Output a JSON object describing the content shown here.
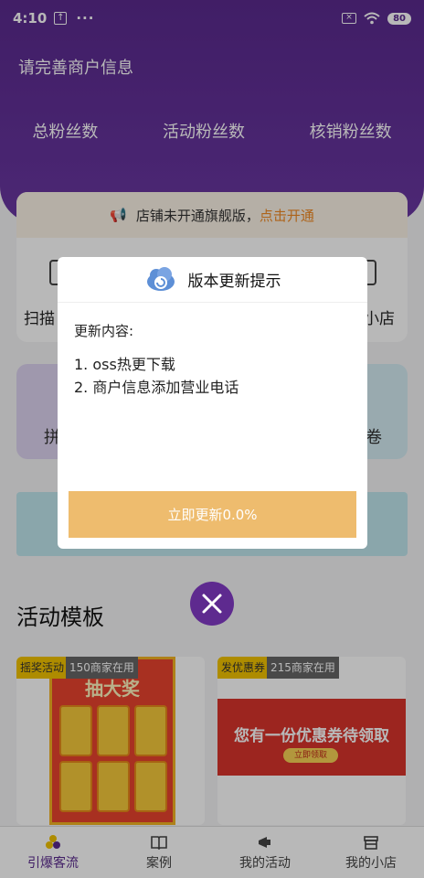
{
  "status_bar": {
    "time": "4:10",
    "battery": "80"
  },
  "header": {
    "title": "请完善商户信息",
    "stats": [
      "总粉丝数",
      "活动粉丝数",
      "核销粉丝数"
    ]
  },
  "notice": {
    "text": "店铺未开通旗舰版，",
    "link": "点击开通"
  },
  "tools": {
    "left_partial": "扫描",
    "right_partial": "小店"
  },
  "cards": {
    "left_partial": "拼",
    "right_partial": "卷"
  },
  "section": {
    "title": "活动模板"
  },
  "templates": [
    {
      "type": "摇奖活动",
      "count": "150商家在用",
      "poster_title": "抽大奖"
    },
    {
      "type": "发优惠券",
      "count": "215商家在用",
      "poster_title": "您有一份优惠券待领取",
      "poster_button": "立即领取"
    }
  ],
  "tabbar": [
    {
      "label": "引爆客流",
      "icon": "flame-flower-icon",
      "active": true
    },
    {
      "label": "案例",
      "icon": "book-icon",
      "active": false
    },
    {
      "label": "我的活动",
      "icon": "megaphone-icon",
      "active": false
    },
    {
      "label": "我的小店",
      "icon": "store-icon",
      "active": false
    }
  ],
  "dialog": {
    "title": "版本更新提示",
    "content_label": "更新内容:",
    "notes": [
      "1. oss热更下载",
      "2. 商户信息添加营业电话"
    ],
    "button": "立即更新0.0%"
  },
  "colors": {
    "brand": "#5a2a8e",
    "accent_orange": "#f08a24",
    "update_button": "#eebc6e"
  }
}
